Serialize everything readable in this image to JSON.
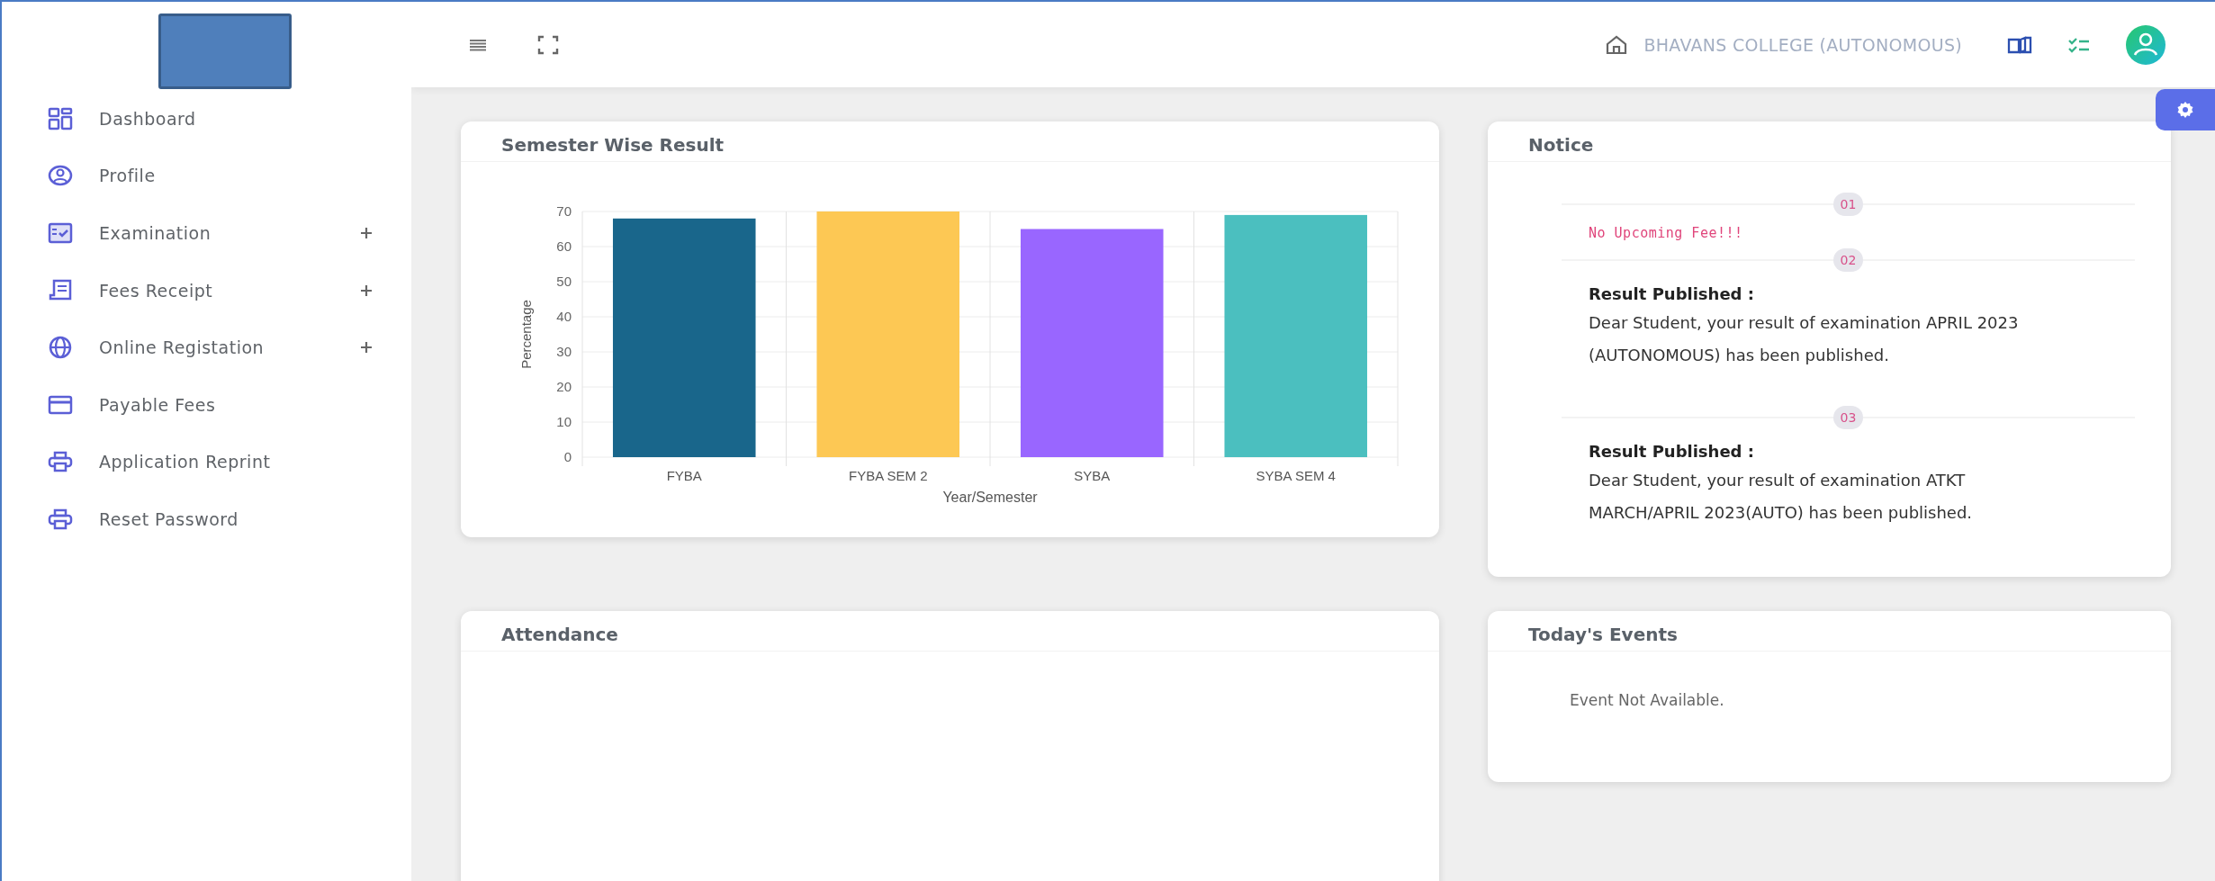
{
  "sidebar": {
    "items": [
      {
        "label": "Dashboard",
        "expandable": false
      },
      {
        "label": "Profile",
        "expandable": false
      },
      {
        "label": "Examination",
        "expandable": true
      },
      {
        "label": "Fees Receipt",
        "expandable": true
      },
      {
        "label": "Online Registation",
        "expandable": true
      },
      {
        "label": "Payable Fees",
        "expandable": false
      },
      {
        "label": "Application Reprint",
        "expandable": false
      },
      {
        "label": "Reset Password",
        "expandable": false
      }
    ]
  },
  "header": {
    "college": "BHAVANS COLLEGE (AUTONOMOUS)"
  },
  "result_card": {
    "title": "Semester Wise Result",
    "chart_data": {
      "type": "bar",
      "xlabel": "Year/Semester",
      "ylabel": "Percentage",
      "categories": [
        "FYBA",
        "FYBA SEM 2",
        "SYBA",
        "SYBA SEM 4"
      ],
      "ylim": [
        0,
        70
      ],
      "yticks": [
        0,
        10,
        20,
        30,
        40,
        50,
        60,
        70
      ],
      "grid": true,
      "series": [
        {
          "values": [
            68,
            70,
            65,
            69
          ]
        }
      ],
      "colors": [
        "#19668b",
        "#fdc854",
        "#9966ff",
        "#4bbfbf"
      ]
    }
  },
  "notice": {
    "title": "Notice",
    "items": [
      {
        "number": "01",
        "kind": "fee",
        "text": "No Upcoming Fee!!!"
      },
      {
        "number": "02",
        "kind": "result",
        "title": "Result Published :",
        "body": "Dear Student, your result of examination APRIL 2023 (AUTONOMOUS) has been published."
      },
      {
        "number": "03",
        "kind": "result",
        "title": "Result Published :",
        "body": "Dear Student, your result of examination ATKT MARCH/APRIL 2023(AUTO) has been published."
      }
    ]
  },
  "attendance": {
    "title": "Attendance"
  },
  "events": {
    "title": "Today's Events",
    "message": "Event Not Available."
  }
}
